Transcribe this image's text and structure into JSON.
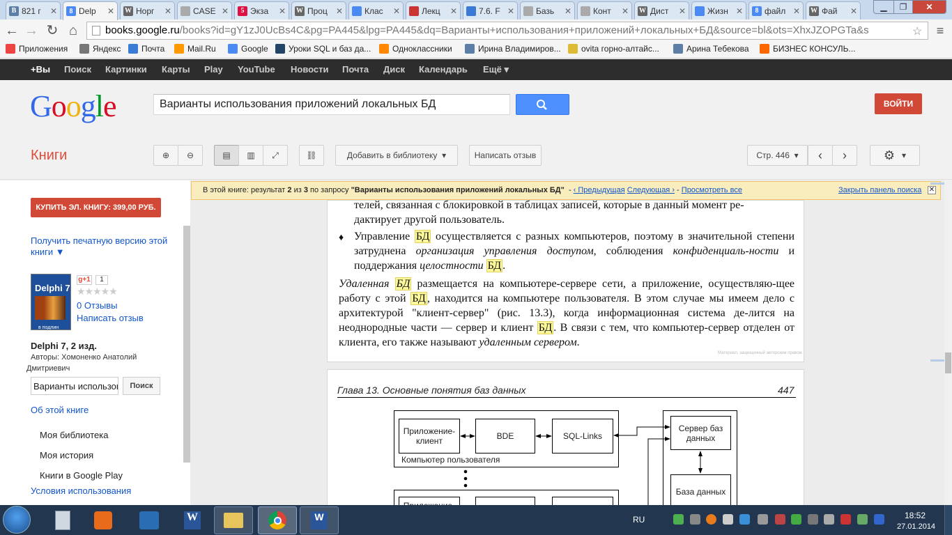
{
  "tabs": [
    {
      "label": "821 г",
      "fav": "B",
      "color": "#5b7fa6"
    },
    {
      "label": "Delp",
      "fav": "8",
      "color": "#4a8af4",
      "active": true
    },
    {
      "label": "Норг",
      "fav": "W",
      "color": "#666"
    },
    {
      "label": "CASE",
      "fav": "",
      "color": "#aaa"
    },
    {
      "label": "Экза",
      "fav": "5",
      "color": "#d14"
    },
    {
      "label": "Проц",
      "fav": "W",
      "color": "#666"
    },
    {
      "label": "Клас",
      "fav": "",
      "color": "#4a8af4"
    },
    {
      "label": "Лекц",
      "fav": "",
      "color": "#c33"
    },
    {
      "label": "7.6. F",
      "fav": "",
      "color": "#3a7bd5"
    },
    {
      "label": "Базь",
      "fav": "",
      "color": "#aaa"
    },
    {
      "label": "Конт",
      "fav": "",
      "color": "#aaa"
    },
    {
      "label": "Дист",
      "fav": "W",
      "color": "#666"
    },
    {
      "label": "Жизн",
      "fav": "",
      "color": "#4a8af4"
    },
    {
      "label": "файл",
      "fav": "8",
      "color": "#4a8af4"
    },
    {
      "label": "Фай",
      "fav": "W",
      "color": "#666"
    }
  ],
  "url": {
    "host": "books.google.ru",
    "path": "/books?id=gY1zJ0UcBs4C&pg=PA445&lpg=PA445&dq=Варианты+использования+приложений+локальных+БД&source=bl&ots=XhxJZOPGTa&s"
  },
  "bookmarks": [
    {
      "label": "Приложения",
      "color": "#e44"
    },
    {
      "label": "Яндекс",
      "color": "#777"
    },
    {
      "label": "Почта",
      "color": "#3a7bd5"
    },
    {
      "label": "Mail.Ru",
      "color": "#f90"
    },
    {
      "label": "Google",
      "color": "#4a8af4"
    },
    {
      "label": "Уроки SQL и баз да...",
      "color": "#246"
    },
    {
      "label": "Одноклассники",
      "color": "#f80"
    },
    {
      "label": "Ирина Владимиров...",
      "color": "#5b7fa6"
    },
    {
      "label": "ovita горно-алтайс...",
      "color": "#db3"
    },
    {
      "label": "Арина Тебекова",
      "color": "#5b7fa6"
    },
    {
      "label": "БИЗНЕС КОНСУЛЬ...",
      "color": "#f60"
    }
  ],
  "gbar": [
    "+Вы",
    "Поиск",
    "Картинки",
    "Карты",
    "Play",
    "YouTube",
    "Новости",
    "Почта",
    "Диск",
    "Календарь",
    "Ещё ▾"
  ],
  "search": {
    "value": "Варианты использования приложений локальных БД"
  },
  "login_label": "ВОЙТИ",
  "books_label": "Книги",
  "toolbar": {
    "add_library": "Добавить в библиотеку",
    "write_review": "Написать отзыв",
    "page": "Стр. 446"
  },
  "sidebar": {
    "buy": "КУПИТЬ ЭЛ. КНИГУ: 399,00 РУБ.",
    "print_version": "Получить печатную версию этой книги ▼",
    "plus_count": "1",
    "reviews": "0 Отзывы",
    "write_review": "Написать отзыв",
    "title": "Delphi 7, 2 изд.",
    "authors_label": "Авторы:",
    "authors": "Хомоненко Анатолий",
    "authors2": "Дмитриевич",
    "search_value": "Варианты использов",
    "search_btn": "Поиск",
    "about": "Об этой книге",
    "my_library": "Моя библиотека",
    "my_history": "Моя история",
    "books_play": "Книги в Google Play",
    "terms": "Условия использования",
    "cover_title": "Delphi 7",
    "cover_sub": "в подлин"
  },
  "notice": {
    "prefix": "В этой книге: результат",
    "n": "2",
    "of": "из",
    "total": "3",
    "query_prefix": "по запросу",
    "query": "\"Варианты использования приложений локальных БД\"",
    "prev": "‹ Предыдущая",
    "next": "Следующая ›",
    "view_all": "Просмотреть все",
    "close": "Закрыть панель поиска"
  },
  "page446": {
    "line_top1": "телей, связанная с блокировкой в таблицах записей, которые в данный момент ре-",
    "line_top2": "дактирует другой пользователь.",
    "b1": "Управление",
    "b2": "осуществляется с разных компьютеров, поэтому в значительной степени затруднена",
    "b3": "организация управления доступом",
    "b4": ", соблюдения",
    "b5": "конфиденциаль-ности",
    "b6": "и поддержания",
    "b7": "целостности",
    "p1": "Удаленная",
    "p2": "размещается на компьютере-сервере сети, а приложение, осуществляю-щее работу с этой",
    "p3": ", находится на компьютере пользователя. В этом случае мы имеем дело с архитектурой \"клиент-сервер\" (рис. 13.3), когда информационная система де-лится на неоднородные части — сервер и клиент",
    "p4": ". В связи с тем, что компьютер-сервер отделен от клиента, его также называют",
    "p5": "удаленным сервером",
    "bd": "БД",
    "watermark": "Материал, защищенный авторским правом"
  },
  "page447": {
    "header_left": "Глава 13. Основные понятия баз данных",
    "header_right": "447",
    "box_app": "Приложение-клиент",
    "box_bde": "BDE",
    "box_sql": "SQL-Links",
    "box_user_pc": "Компьютер пользователя",
    "box_server": "Сервер баз данных",
    "box_db": "База данных",
    "box_app2": "Приложение-"
  },
  "taskbar": {
    "lang": "RU",
    "time": "18:52",
    "date": "27.01.2014"
  }
}
